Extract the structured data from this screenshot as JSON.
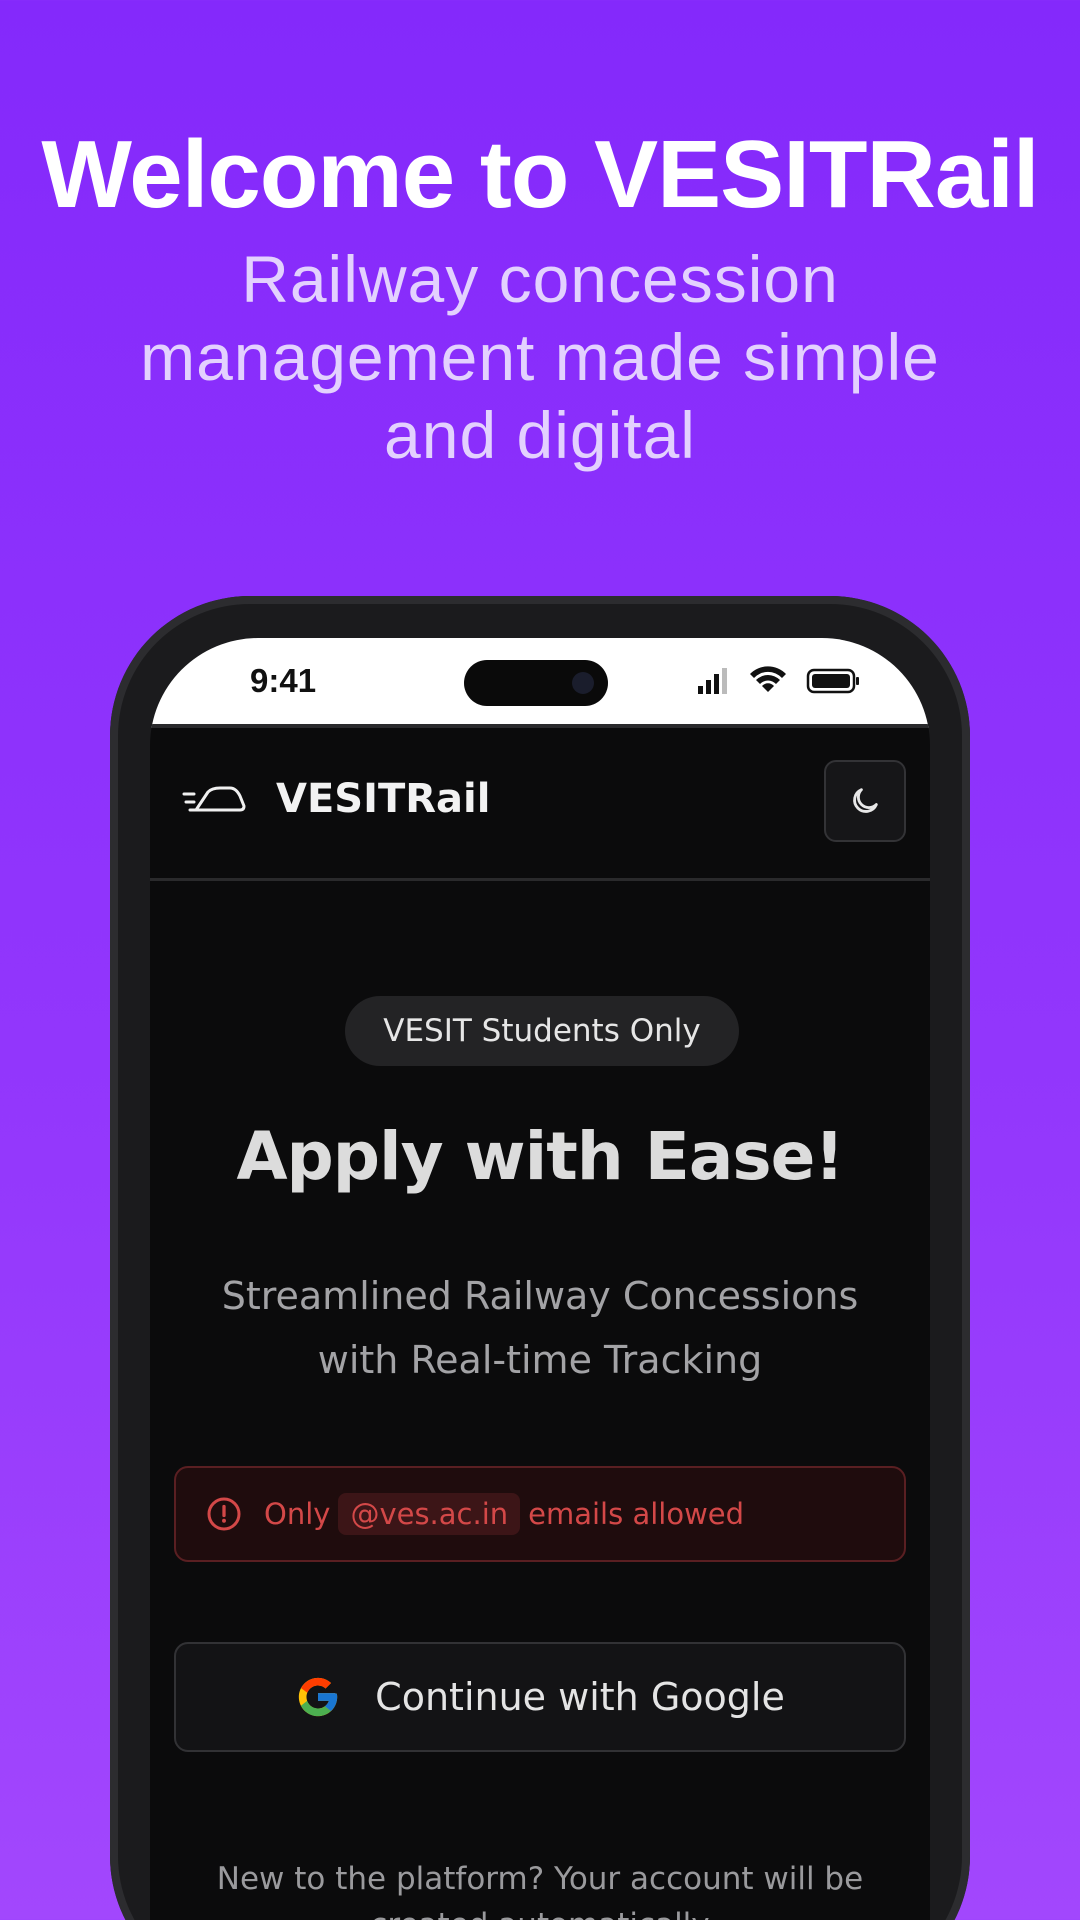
{
  "hero": {
    "title": "Welcome to VESITRail",
    "subtitle": "Railway concession management made simple and digital"
  },
  "status_bar": {
    "time": "9:41",
    "icons": [
      "signal-icon",
      "wifi-icon",
      "battery-icon"
    ]
  },
  "app_header": {
    "logo_icon": "train-icon",
    "app_name": "VESITRail",
    "theme_toggle_icon": "moon-icon"
  },
  "main": {
    "badge": "VESIT Students Only",
    "heading": "Apply with Ease!",
    "subheading": "Streamlined Railway Concessions with Real-time Tracking",
    "alert": {
      "icon": "alert-circle-icon",
      "prefix": "Only",
      "domain": "@ves.ac.in",
      "suffix": "emails allowed"
    },
    "google_button": {
      "icon": "google-icon",
      "label": "Continue with Google"
    },
    "footnote": "New to the platform? Your account will be created automatically"
  },
  "colors": {
    "background_top": "#8429fb",
    "background_bottom": "#a247fd",
    "app_background": "#0b0b0c",
    "alert_text": "#d34848"
  }
}
